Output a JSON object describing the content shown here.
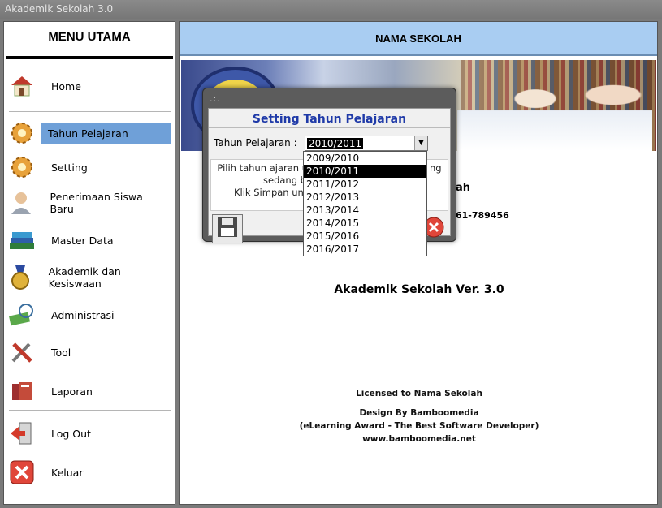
{
  "window": {
    "title": "Akademik Sekolah 3.0"
  },
  "sidebar": {
    "title": "MENU UTAMA",
    "items": [
      {
        "label": "Home",
        "icon": "house-icon"
      },
      {
        "label": "Tahun Pelajaran",
        "icon": "gear-icon",
        "active": true
      },
      {
        "label": "Setting",
        "icon": "gear-icon"
      },
      {
        "label": "Penerimaan Siswa Baru",
        "icon": "user-icon"
      },
      {
        "label": "Master Data",
        "icon": "books-icon"
      },
      {
        "label": "Akademik dan Kesiswaan",
        "icon": "medal-icon"
      },
      {
        "label": "Administrasi",
        "icon": "money-icon"
      },
      {
        "label": "Tool",
        "icon": "tools-icon"
      },
      {
        "label": "Laporan",
        "icon": "report-icon"
      },
      {
        "label": "Log Out",
        "icon": "logout-icon"
      },
      {
        "label": "Keluar",
        "icon": "close-icon"
      }
    ]
  },
  "main": {
    "header": "NAMA SEKOLAH",
    "school_name_partial": "ah",
    "school_phone_partial": "61-789456",
    "version": "Akademik Sekolah Ver. 3.0",
    "credits": {
      "licensed": "Licensed to Nama Sekolah",
      "design": "Design By Bamboomedia",
      "award": "(eLearning Award - The Best Software Developer)",
      "url": "www.bamboomedia.net"
    }
  },
  "dialog": {
    "grip": ".:.",
    "title": "Setting Tahun Pelajaran",
    "field_label": "Tahun Pelajaran  :",
    "selected": "2010/2011",
    "info_line1": "Pilih tahun ajaran u",
    "info_line1_tail": "ng",
    "info_line2": "sedang be",
    "info_line3": "Klik Simpan untu",
    "options": [
      "2009/2010",
      "2010/2011",
      "2011/2012",
      "2012/2013",
      "2013/2014",
      "2014/2015",
      "2015/2016",
      "2016/2017"
    ],
    "selected_index": 1
  }
}
